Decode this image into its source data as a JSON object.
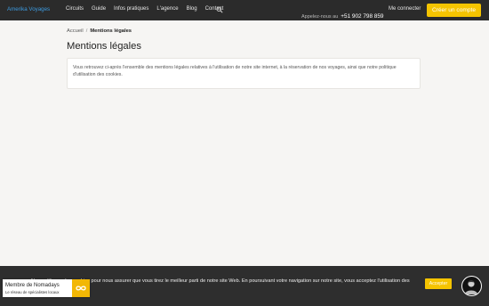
{
  "header": {
    "brand": "Amerika Voyages",
    "nav": [
      "Circuits",
      "Guide",
      "Infos pratiques",
      "L'agence",
      "Blog",
      "Contact"
    ],
    "search_icon": "search-icon",
    "call_label": "Appelez-nous au",
    "phone": "+51 902 798 859",
    "login": "Me connecter",
    "cta": "Créer un compte"
  },
  "breadcrumb": {
    "home": "Accueil",
    "separator": "/",
    "current": "Mentions légales"
  },
  "page": {
    "title": "Mentions légales",
    "body": "Vous retrouvez ci-après l'ensemble des mentions légales relatives à l'utilisation de notre site internet, à la réservation de nos voyages, ainsi que notre politique d'utilisation des cookies."
  },
  "cookie_banner": {
    "text": "Nous utilisons des cookies pour nous assurer que vous tirez le meilleur parti de notre site Web. En poursuivant votre navigation sur notre site, vous acceptez l'utilisation des cookies",
    "accept": "Accepter"
  },
  "badge": {
    "title": "Membre de Nomadays",
    "subtitle": "Le réseau de spécialistes locaux",
    "logo_icon": "infinity-icon"
  },
  "avatar": {
    "icon": "advisor-avatar-icon"
  },
  "colors": {
    "navbar": "#2b2b2b",
    "brand": "#3d9be0",
    "accent": "#f5c400",
    "page_bg": "#f6f5f3"
  }
}
